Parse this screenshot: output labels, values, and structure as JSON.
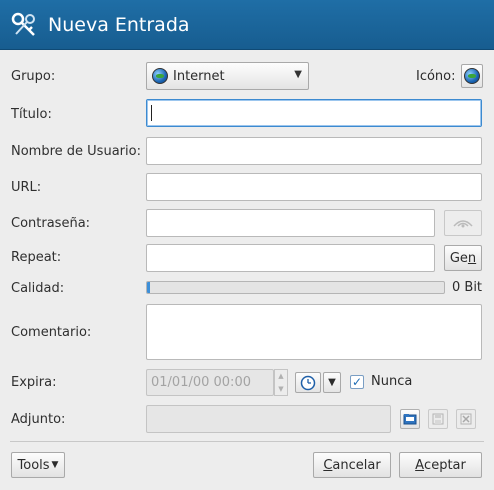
{
  "window": {
    "title": "Nueva Entrada",
    "app_icon": "keys-icon"
  },
  "form": {
    "group": {
      "label": "Grupo:",
      "value": "Internet",
      "icon": "globe-icon"
    },
    "icon": {
      "label": "Icóno:"
    },
    "title": {
      "label": "Título:",
      "value": ""
    },
    "username": {
      "label": "Nombre de Usuario:",
      "value": ""
    },
    "url": {
      "label": "URL:",
      "value": ""
    },
    "password": {
      "label": "Contraseña:",
      "value": ""
    },
    "repeat": {
      "label": "Repeat:",
      "value": "",
      "gen_label_pre": "Ge",
      "gen_label_u": "n"
    },
    "quality": {
      "label": "Calidad:",
      "value_text": "0 Bit",
      "fraction": 0.01
    },
    "comment": {
      "label": "Comentario:",
      "value": ""
    },
    "expires": {
      "label": "Expira:",
      "date_value": "01/01/00 00:00",
      "never_label": "Nunca",
      "never_checked": true
    },
    "attachment": {
      "label": "Adjunto:",
      "value": ""
    }
  },
  "footer": {
    "tools_label": "Tools",
    "cancel_label_u": "C",
    "cancel_label_rest": "ancelar",
    "accept_label_u": "A",
    "accept_label_rest": "ceptar"
  }
}
